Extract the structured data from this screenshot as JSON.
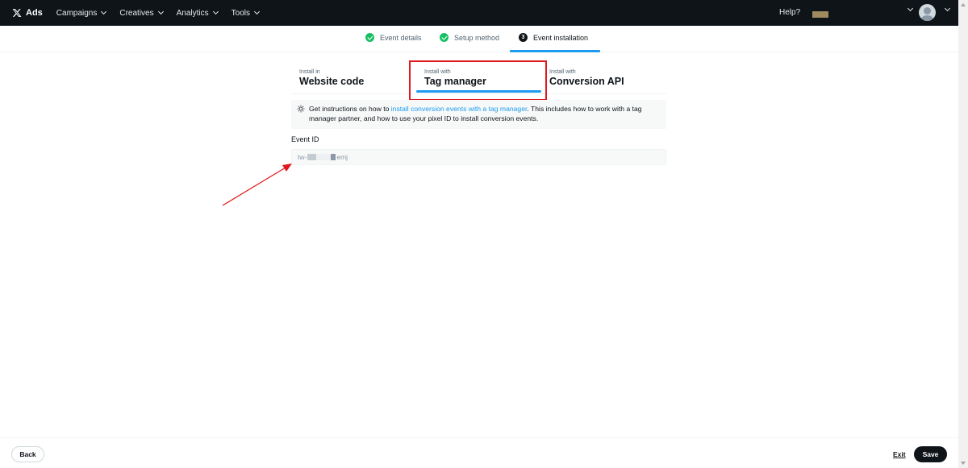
{
  "topnav": {
    "brand": "Ads",
    "menu": [
      {
        "label": "Campaigns"
      },
      {
        "label": "Creatives"
      },
      {
        "label": "Analytics"
      },
      {
        "label": "Tools"
      }
    ],
    "help": "Help?"
  },
  "stepper": {
    "steps": [
      {
        "label": "Event details",
        "status": "complete"
      },
      {
        "label": "Setup method",
        "status": "complete"
      },
      {
        "label": "Event installation",
        "status": "active",
        "number": "3"
      }
    ]
  },
  "tabs": [
    {
      "sub": "Install in",
      "label": "Website code",
      "selected": false
    },
    {
      "sub": "Install with",
      "label": "Tag manager",
      "selected": true
    },
    {
      "sub": "Install with",
      "label": "Conversion API",
      "selected": false
    }
  ],
  "info": {
    "prefix": "Get instructions on how to ",
    "link": "install conversion events with a tag manager",
    "suffix": ". This includes how to work with a tag manager partner, and how to use your pixel ID to install conversion events."
  },
  "event_id": {
    "label": "Event ID",
    "value_prefix": "tw-",
    "value_suffix": "emj"
  },
  "footer": {
    "back": "Back",
    "exit": "Exit",
    "save": "Save"
  },
  "colors": {
    "accent": "#1d9bf0",
    "success": "#17bf63",
    "nav_bg": "#0f1419",
    "annotation": "#e0191e"
  }
}
